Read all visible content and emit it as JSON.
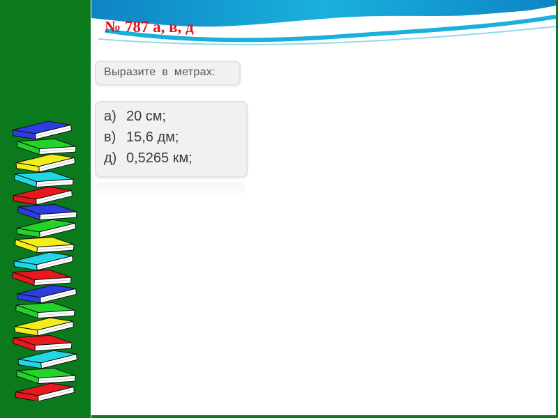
{
  "colors": {
    "background_green": "#0b7a1d",
    "title_red": "#e3141b",
    "wave_cyan": "#1ab0dc",
    "text_gray": "#3a3a3a",
    "book_colors": [
      "#2d3ee0",
      "#22d42a",
      "#f2ee1c",
      "#1fd7e5",
      "#e8181c"
    ]
  },
  "slide": {
    "title": "№ 787 а, в, д",
    "prompt": "Выразите в метрах:",
    "items": [
      {
        "letter": "а)",
        "value": "20 см;"
      },
      {
        "letter": "в)",
        "value": "15,6 дм;"
      },
      {
        "letter": "д)",
        "value": "0,5265 км;"
      }
    ]
  },
  "decor": {
    "left_icon": "book-stack-icon",
    "top_icon": "wave-decoration-icon"
  }
}
